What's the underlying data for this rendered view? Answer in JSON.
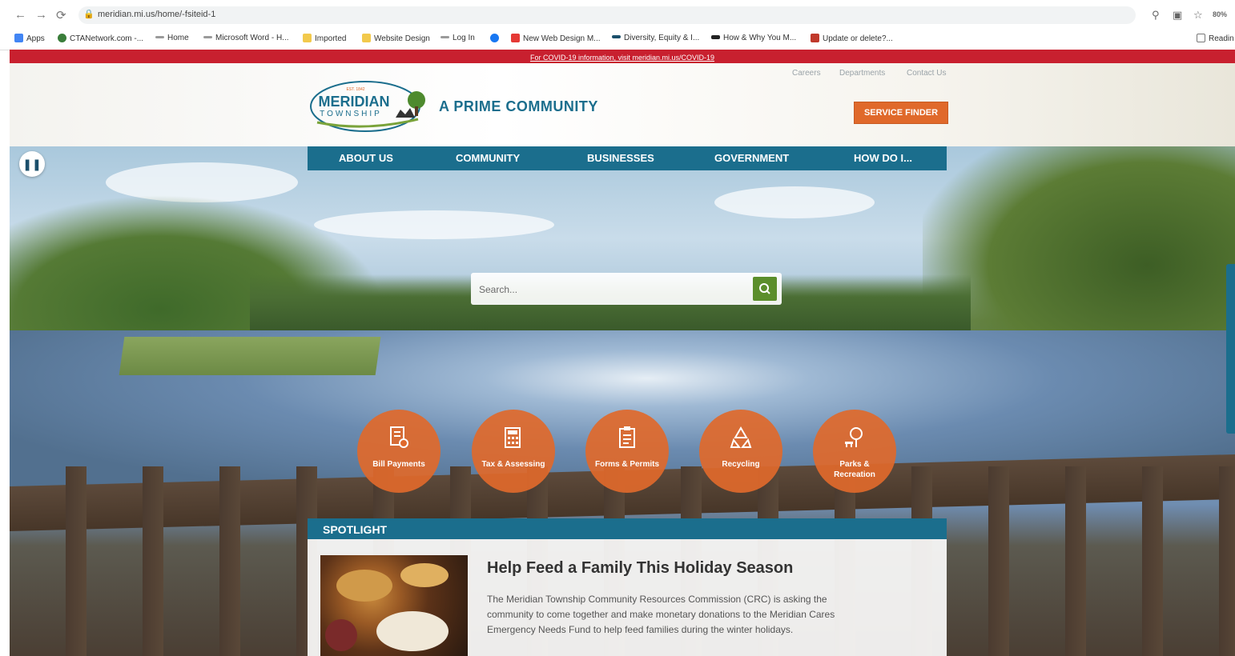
{
  "browser": {
    "url": "meridian.mi.us/home/-fsiteid-1",
    "zoom": "80%",
    "bookmarks": [
      {
        "label": "Apps",
        "color": "#4285f4"
      },
      {
        "label": "CTANetwork.com -...",
        "color": "#3a7d3a"
      },
      {
        "label": "Home",
        "color": "#7a7a7a"
      },
      {
        "label": "Microsoft Word - H...",
        "color": "#7a7a7a"
      },
      {
        "label": "Imported",
        "color": "#f2c94c"
      },
      {
        "label": "Website Design",
        "color": "#f2c94c"
      },
      {
        "label": "Log In",
        "color": "#7a7a7a"
      },
      {
        "label": "",
        "color": "#1877f2"
      },
      {
        "label": "New Web Design M...",
        "color": "#e53935"
      },
      {
        "label": "Diversity, Equity & I...",
        "color": "#1b4f6b"
      },
      {
        "label": "How & Why You M...",
        "color": "#222222"
      },
      {
        "label": "Update or delete?...",
        "color": "#c0392b"
      },
      {
        "label": "Readin",
        "color": "#777777"
      }
    ]
  },
  "alert": {
    "text": "For COVID-19 information, visit meridian.mi.us/COVID-19"
  },
  "header": {
    "utility_links": [
      "Careers",
      "Departments",
      "Contact Us"
    ],
    "logo": {
      "est": "EST. 1842",
      "name": "MERIDIAN",
      "sub": "TOWNSHIP"
    },
    "tagline": "A PRIME COMMUNITY",
    "service_finder": "SERVICE FINDER"
  },
  "nav": [
    "ABOUT US",
    "COMMUNITY",
    "BUSINESSES",
    "GOVERNMENT",
    "HOW DO I..."
  ],
  "search": {
    "placeholder": "Search..."
  },
  "quick_links": [
    {
      "line1": "Bill Payments",
      "line2": "",
      "icon": "bill-icon"
    },
    {
      "line1": "Tax & Assessing",
      "line2": "",
      "icon": "calculator-icon"
    },
    {
      "line1": "Forms & Permits",
      "line2": "",
      "icon": "forms-icon"
    },
    {
      "line1": "Recycling",
      "line2": "",
      "icon": "recycle-icon"
    },
    {
      "line1": "Parks &",
      "line2": "Recreation",
      "icon": "park-icon"
    }
  ],
  "spotlight": {
    "heading": "SPOTLIGHT",
    "title": "Help Feed a Family This Holiday Season",
    "body": "The Meridian Township Community Resources Commission (CRC) is asking the community to come together and make monetary donations to the Meridian Cares Emergency Needs Fund to help feed families during the winter holidays."
  },
  "colors": {
    "brand_blue": "#1b6e8d",
    "accent_orange": "#e0692b",
    "alert_red": "#c8202f",
    "search_green": "#5b8e2b"
  }
}
